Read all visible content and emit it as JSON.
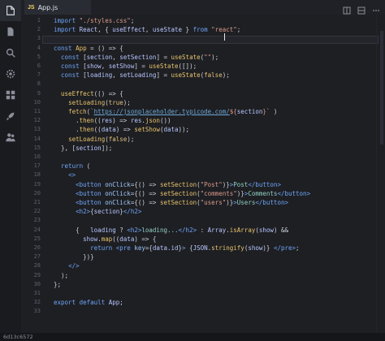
{
  "tabs": [
    {
      "lang": "JS",
      "label": "App.js"
    }
  ],
  "activity_bar": [
    "files-icon",
    "file-icon",
    "search-icon",
    "gear-icon",
    "extensions-icon",
    "rocket-icon",
    "users-icon"
  ],
  "tab_actions": [
    "split-editor-icon",
    "layout-icon",
    "more-icon"
  ],
  "status_bar": {
    "left": "6d13c6572"
  },
  "line_numbers": [
    "1",
    "2",
    "3",
    "4",
    "5",
    "6",
    "7",
    "8",
    "9",
    "10",
    "11",
    "12",
    "13",
    "14",
    "15",
    "16",
    "17",
    "18",
    "19",
    "20",
    "21",
    "22",
    "23",
    "24",
    "25",
    "26",
    "27",
    "28",
    "29",
    "30",
    "31",
    "32",
    "33"
  ],
  "code": [
    [
      [
        "k",
        "import "
      ],
      [
        "s",
        "\"./styles.css\""
      ],
      [
        "p",
        ";"
      ]
    ],
    [
      [
        "k",
        "import "
      ],
      [
        "v",
        "React"
      ],
      [
        "p",
        ", { "
      ],
      [
        "v",
        "useEffect"
      ],
      [
        "p",
        ", "
      ],
      [
        "v",
        "useState"
      ],
      [
        "p",
        " } "
      ],
      [
        "k",
        "from "
      ],
      [
        "s",
        "\"react\""
      ],
      [
        "p",
        ";"
      ]
    ],
    [
      [
        "p",
        ""
      ]
    ],
    [
      [
        "k",
        "const "
      ],
      [
        "f",
        "App"
      ],
      [
        "p",
        " = () => {"
      ]
    ],
    [
      [
        "p",
        "  "
      ],
      [
        "k",
        "const "
      ],
      [
        "p",
        "["
      ],
      [
        "v",
        "section"
      ],
      [
        "p",
        ", "
      ],
      [
        "v",
        "setSection"
      ],
      [
        "p",
        "] = "
      ],
      [
        "f",
        "useState"
      ],
      [
        "p",
        "("
      ],
      [
        "s",
        "\"\""
      ],
      [
        "p",
        ");"
      ]
    ],
    [
      [
        "p",
        "  "
      ],
      [
        "k",
        "const "
      ],
      [
        "p",
        "["
      ],
      [
        "v",
        "show"
      ],
      [
        "p",
        ", "
      ],
      [
        "v",
        "setShow"
      ],
      [
        "p",
        "] = "
      ],
      [
        "f",
        "useState"
      ],
      [
        "p",
        "([]);"
      ]
    ],
    [
      [
        "p",
        "  "
      ],
      [
        "k",
        "const "
      ],
      [
        "p",
        "["
      ],
      [
        "v",
        "loading"
      ],
      [
        "p",
        ", "
      ],
      [
        "v",
        "setLoading"
      ],
      [
        "p",
        "] = "
      ],
      [
        "f",
        "useState"
      ],
      [
        "p",
        "("
      ],
      [
        "b",
        "false"
      ],
      [
        "p",
        ");"
      ]
    ],
    [
      [
        "p",
        ""
      ]
    ],
    [
      [
        "p",
        "  "
      ],
      [
        "f",
        "useEffect"
      ],
      [
        "p",
        "(() => {"
      ]
    ],
    [
      [
        "p",
        "    "
      ],
      [
        "f",
        "setLoading"
      ],
      [
        "p",
        "("
      ],
      [
        "b",
        "true"
      ],
      [
        "p",
        ");"
      ]
    ],
    [
      [
        "p",
        "    "
      ],
      [
        "f",
        "fetch"
      ],
      [
        "p",
        "("
      ],
      [
        "tpl",
        "`"
      ],
      [
        "u",
        "https://jsonplaceholder.typicode.com/"
      ],
      [
        "tpl",
        "${"
      ],
      [
        "v",
        "section"
      ],
      [
        "tpl",
        "}`"
      ],
      [
        "p",
        " )"
      ]
    ],
    [
      [
        "p",
        "      ."
      ],
      [
        "f",
        "then"
      ],
      [
        "p",
        "(("
      ],
      [
        "v",
        "res"
      ],
      [
        "p",
        ") => "
      ],
      [
        "v",
        "res"
      ],
      [
        "p",
        "."
      ],
      [
        "f",
        "json"
      ],
      [
        "p",
        "())"
      ]
    ],
    [
      [
        "p",
        "      ."
      ],
      [
        "f",
        "then"
      ],
      [
        "p",
        "(("
      ],
      [
        "v",
        "data"
      ],
      [
        "p",
        ") => "
      ],
      [
        "f",
        "setShow"
      ],
      [
        "p",
        "("
      ],
      [
        "v",
        "data"
      ],
      [
        "p",
        "));"
      ]
    ],
    [
      [
        "p",
        "    "
      ],
      [
        "f",
        "setLoading"
      ],
      [
        "p",
        "("
      ],
      [
        "b",
        "false"
      ],
      [
        "p",
        ");"
      ]
    ],
    [
      [
        "p",
        "  }, ["
      ],
      [
        "v",
        "section"
      ],
      [
        "p",
        "]);"
      ]
    ],
    [
      [
        "p",
        ""
      ]
    ],
    [
      [
        "p",
        "  "
      ],
      [
        "k",
        "return "
      ],
      [
        "p",
        "("
      ]
    ],
    [
      [
        "p",
        "    "
      ],
      [
        "t",
        "<>"
      ]
    ],
    [
      [
        "p",
        "      "
      ],
      [
        "t",
        "<button "
      ],
      [
        "a",
        "onClick"
      ],
      [
        "p",
        "={() => "
      ],
      [
        "f",
        "setSection"
      ],
      [
        "p",
        "("
      ],
      [
        "s",
        "\"Post\""
      ],
      [
        "p",
        ")}"
      ],
      [
        "t",
        ">"
      ],
      [
        "c",
        "Post"
      ],
      [
        "t",
        "</button>"
      ]
    ],
    [
      [
        "p",
        "      "
      ],
      [
        "t",
        "<button "
      ],
      [
        "a",
        "onClick"
      ],
      [
        "p",
        "={() => "
      ],
      [
        "f",
        "setSection"
      ],
      [
        "p",
        "("
      ],
      [
        "s",
        "\"comments\""
      ],
      [
        "p",
        ")}"
      ],
      [
        "t",
        ">"
      ],
      [
        "c",
        "Comments"
      ],
      [
        "t",
        "</button>"
      ]
    ],
    [
      [
        "p",
        "      "
      ],
      [
        "t",
        "<button "
      ],
      [
        "a",
        "onClick"
      ],
      [
        "p",
        "={() => "
      ],
      [
        "f",
        "setSection"
      ],
      [
        "p",
        "("
      ],
      [
        "s",
        "\"users\""
      ],
      [
        "p",
        ")}"
      ],
      [
        "t",
        ">"
      ],
      [
        "c",
        "Users"
      ],
      [
        "t",
        "</button>"
      ]
    ],
    [
      [
        "p",
        "      "
      ],
      [
        "t",
        "<h2>"
      ],
      [
        "p",
        "{"
      ],
      [
        "v",
        "section"
      ],
      [
        "p",
        "}"
      ],
      [
        "t",
        "</h2>"
      ]
    ],
    [
      [
        "p",
        ""
      ]
    ],
    [
      [
        "p",
        "      {   "
      ],
      [
        "v",
        "loading"
      ],
      [
        "p",
        " ? "
      ],
      [
        "t",
        "<h2>"
      ],
      [
        "c",
        "loading..."
      ],
      [
        "t",
        "</h2>"
      ],
      [
        "p",
        " : "
      ],
      [
        "v",
        "Array"
      ],
      [
        "p",
        "."
      ],
      [
        "f",
        "isArray"
      ],
      [
        "p",
        "("
      ],
      [
        "v",
        "show"
      ],
      [
        "p",
        ") &&"
      ]
    ],
    [
      [
        "p",
        "        "
      ],
      [
        "v",
        "show"
      ],
      [
        "p",
        "."
      ],
      [
        "f",
        "map"
      ],
      [
        "p",
        "(("
      ],
      [
        "v",
        "data"
      ],
      [
        "p",
        ") => {"
      ]
    ],
    [
      [
        "p",
        "          "
      ],
      [
        "k",
        "return "
      ],
      [
        "t",
        "<pre "
      ],
      [
        "a",
        "key"
      ],
      [
        "p",
        "={"
      ],
      [
        "v",
        "data"
      ],
      [
        "p",
        "."
      ],
      [
        "v",
        "id"
      ],
      [
        "p",
        "}"
      ],
      [
        "t",
        ">"
      ],
      [
        "p",
        " {"
      ],
      [
        "v",
        "JSON"
      ],
      [
        "p",
        "."
      ],
      [
        "f",
        "stringify"
      ],
      [
        "p",
        "("
      ],
      [
        "v",
        "show"
      ],
      [
        "p",
        ")} "
      ],
      [
        "t",
        "</pre>"
      ],
      [
        "p",
        ";"
      ]
    ],
    [
      [
        "p",
        "        })}"
      ]
    ],
    [
      [
        "p",
        "    "
      ],
      [
        "t",
        "</>"
      ]
    ],
    [
      [
        "p",
        "  );"
      ]
    ],
    [
      [
        "p",
        "};"
      ]
    ],
    [
      [
        "p",
        ""
      ]
    ],
    [
      [
        "k",
        "export "
      ],
      [
        "k",
        "default "
      ],
      [
        "v",
        "App"
      ],
      [
        "p",
        ";"
      ]
    ],
    [
      [
        "p",
        ""
      ]
    ]
  ]
}
